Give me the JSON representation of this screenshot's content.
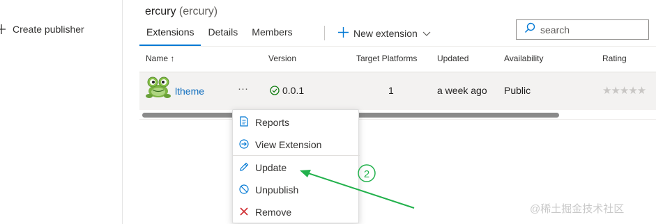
{
  "sidebar": {
    "create_publisher_label": "Create publisher"
  },
  "publisher": {
    "name": "ercury",
    "id": "(ercury)"
  },
  "tabs": [
    {
      "label": "Extensions"
    },
    {
      "label": "Details"
    },
    {
      "label": "Members"
    }
  ],
  "toolbar": {
    "new_extension_label": "New extension"
  },
  "search": {
    "placeholder": "search"
  },
  "table": {
    "columns": [
      "Name ↑",
      "Version",
      "Target Platforms",
      "Updated",
      "Availability",
      "Rating"
    ],
    "rows": [
      {
        "name": "ltheme",
        "more": "···",
        "version": "0.0.1",
        "target_platforms": "1",
        "updated": "a week ago",
        "availability": "Public",
        "rating": "★★★★★"
      }
    ]
  },
  "context_menu": {
    "items": [
      {
        "label": "Reports",
        "icon": "report-icon"
      },
      {
        "label": "View Extension",
        "icon": "arrow-circle-icon"
      },
      {
        "label": "Update",
        "icon": "pencil-icon"
      },
      {
        "label": "Unpublish",
        "icon": "block-icon"
      },
      {
        "label": "Remove",
        "icon": "close-icon"
      }
    ]
  },
  "annotation": {
    "step": "2",
    "color": "#22b14c"
  },
  "watermark": "@稀土掘金技术社区",
  "colors": {
    "accent": "#0078d4",
    "link": "#106ebe",
    "success": "#107c10",
    "remove": "#d13438"
  }
}
